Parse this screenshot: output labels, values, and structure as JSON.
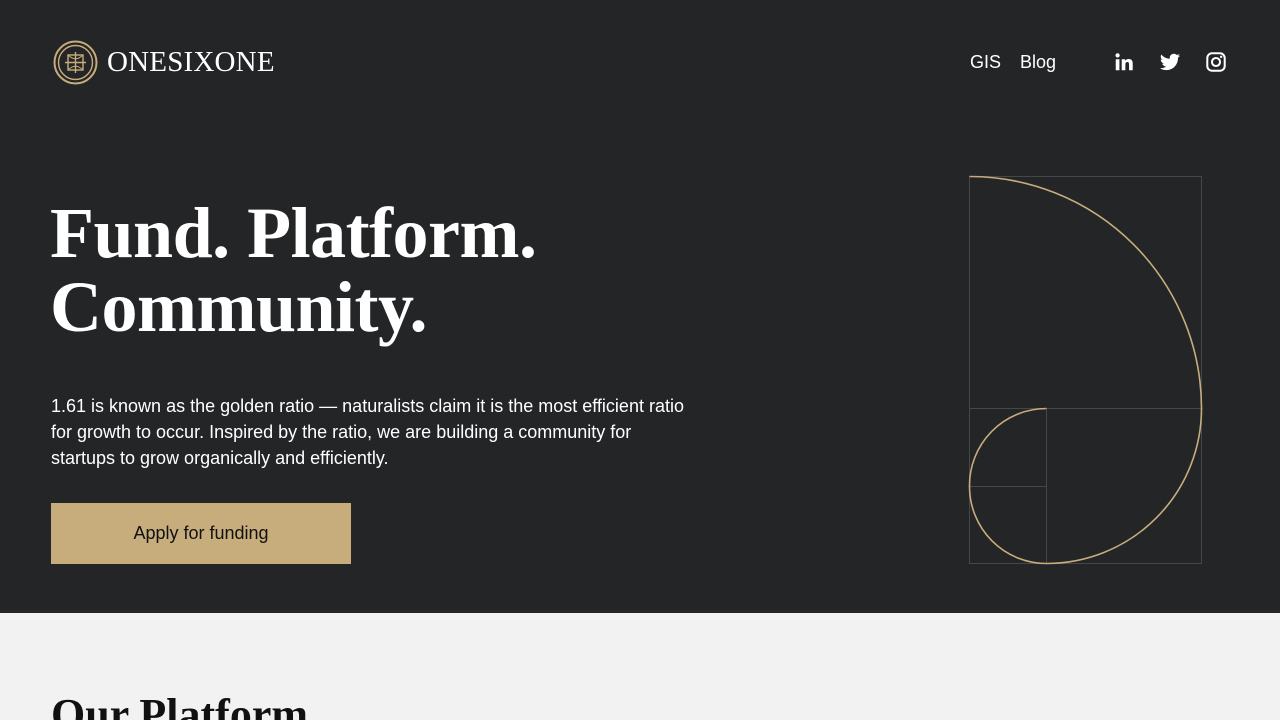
{
  "brand": {
    "name": "ONESIXONE"
  },
  "nav": {
    "links": [
      "GIS",
      "Blog"
    ],
    "social": [
      "linkedin-icon",
      "twitter-icon",
      "instagram-icon"
    ]
  },
  "hero": {
    "headline_line1": "Fund. Platform.",
    "headline_line2": "Community.",
    "intro": "1.61 is known as the golden ratio — naturalists claim it is the most efficient ratio for growth to occur. Inspired by the ratio, we are building a community for startups to grow organically and efficiently.",
    "cta_label": "Apply for funding"
  },
  "platform": {
    "title": "Our Platform"
  },
  "colors": {
    "hero_background": "#232527",
    "accent_gold": "#c8ad7c",
    "page_background": "#f2f2f2",
    "text_light": "#ffffff"
  }
}
